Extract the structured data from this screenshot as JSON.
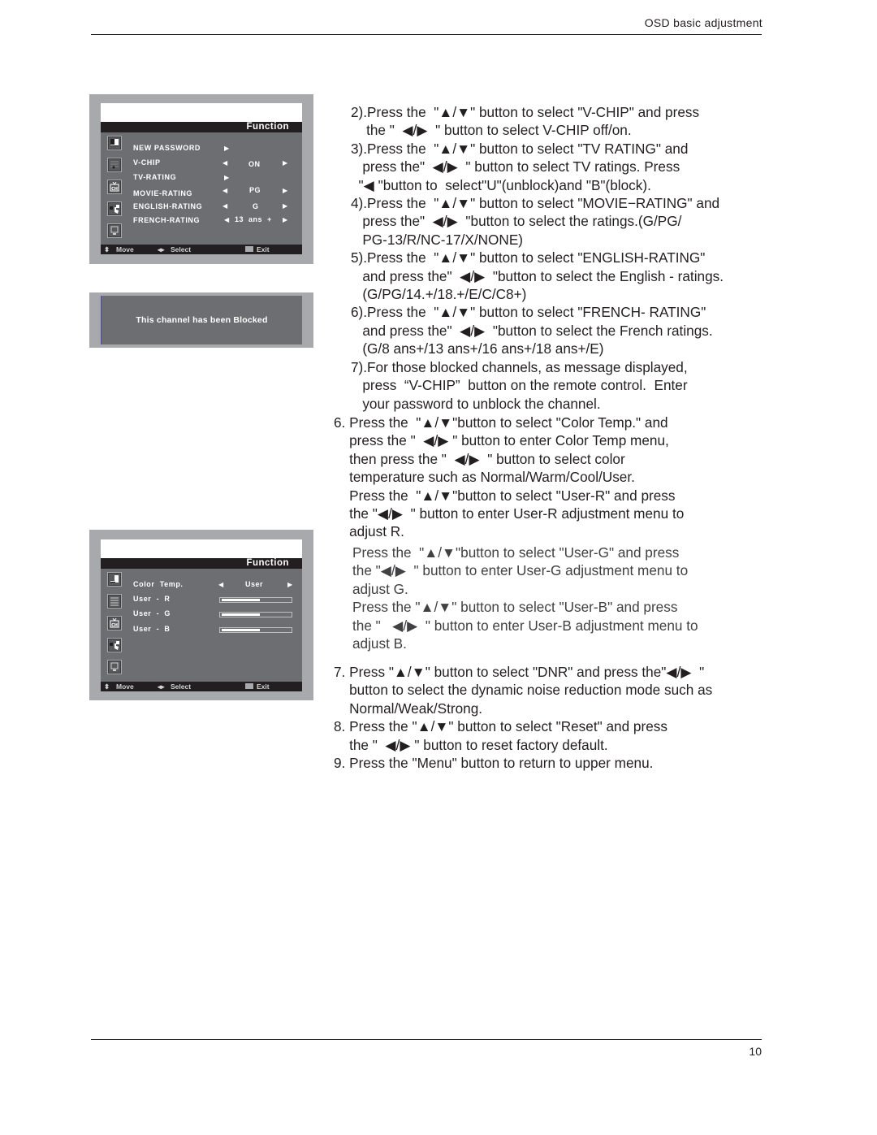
{
  "header": {
    "title": "OSD basic adjustment"
  },
  "footer": {
    "page_number": "10"
  },
  "osd_vchip": {
    "title": "Function",
    "icons": [
      "picture-icon",
      "sound-icon",
      "channel-icon",
      "function-icon",
      "screen-icon"
    ],
    "items": [
      {
        "label": "NEW PASSWORD",
        "value": "",
        "left_arrow": false,
        "right_arrow": true
      },
      {
        "label": "V-CHIP",
        "value": "ON",
        "left_arrow": true,
        "right_arrow": true
      },
      {
        "label": "TV-RATING",
        "value": "",
        "left_arrow": false,
        "right_arrow": true
      },
      {
        "label": "MOVIE-RATING",
        "value": "PG",
        "left_arrow": true,
        "right_arrow": true
      },
      {
        "label": "ENGLISH-RATING",
        "value": "G",
        "left_arrow": true,
        "right_arrow": true
      },
      {
        "label": "FRENCH-RATING",
        "value": "13  ans  +",
        "left_arrow": true,
        "right_arrow": true
      }
    ],
    "footer": {
      "move": "Move",
      "select": "Select",
      "exit": "Exit"
    }
  },
  "blocked_message": {
    "text": "This channel has been Blocked"
  },
  "osd_color": {
    "title": "Function",
    "items": [
      {
        "label": "Color  Temp.",
        "value": "User"
      },
      {
        "label": "User  -  R",
        "level_percent": 56
      },
      {
        "label": "User  -  G",
        "level_percent": 56
      },
      {
        "label": "User  -  B",
        "level_percent": 56
      }
    ],
    "footer": {
      "move": "Move",
      "select": "Select",
      "exit": "Exit"
    }
  },
  "instructions": {
    "vchip_steps": [
      "2).Press the  \"▲/▼\" button to select \"V-CHIP\" and press",
      "    the \"  ◀/▶  \" button to select V-CHIP off/on.",
      "3).Press the  \"▲/▼\" button to select \"TV RATING\" and",
      "   press the\"  ◀/▶  \" button to select TV ratings. Press",
      "  \"◀ \"button to  select\"U\"(unblock)and \"B\"(block).",
      "4).Press the  \"▲/▼\" button to select \"MOVIE−RATING\" and",
      "   press the\"  ◀/▶  \"button to select the ratings.(G/PG/",
      "   PG-13/R/NC-17/X/NONE)",
      "5).Press the  \"▲/▼\" button to select \"ENGLISH-RATING\"",
      "   and press the\"  ◀/▶  \"button to select the English - ratings.",
      "   (G/PG/14.+/18.+/E/C/C8+)",
      "6).Press the  \"▲/▼\" button to select \"FRENCH- RATING\"",
      "   and press the\"  ◀/▶  \"button to select the French ratings.",
      "   (G/8 ans+/13 ans+/16 ans+/18 ans+/E)",
      "7).For those blocked channels, as message displayed,",
      "   press  “V-CHIP”  button on the remote control.  Enter",
      "   your password to unblock the channel."
    ],
    "color_step": [
      "6. Press the  \"▲/▼\"button to select \"Color Temp.\" and",
      "    press the \"  ◀/▶ \" button to enter Color Temp menu,",
      "    then press the \"  ◀/▶  \" button to select color",
      "    temperature such as Normal/Warm/Cool/User.",
      "    Press the  \"▲/▼\"button to select \"User-R\" and press",
      "    the \"◀/▶  \" button to enter User-R adjustment menu to",
      "    adjust R."
    ],
    "color_step_cont": [
      "Press the  \"▲/▼\"button to select \"User-G\" and press",
      "the \"◀/▶  \" button to enter User-G adjustment menu to",
      "adjust G.",
      "Press the \"▲/▼\" button to select \"User-B\" and press",
      "the \"   ◀/▶  \" button to enter User-B adjustment menu to",
      "adjust B."
    ],
    "final_steps": [
      "7. Press \"▲/▼\" button to select \"DNR\" and press the\"◀/▶  \"",
      "    button to select the dynamic noise reduction mode such as",
      "    Normal/Weak/Strong.",
      "8. Press the \"▲/▼\" button to select \"Reset\" and press",
      "    the \"  ◀/▶ \" button to reset factory default.",
      "9. Press the \"Menu\" button to return to upper menu."
    ]
  }
}
